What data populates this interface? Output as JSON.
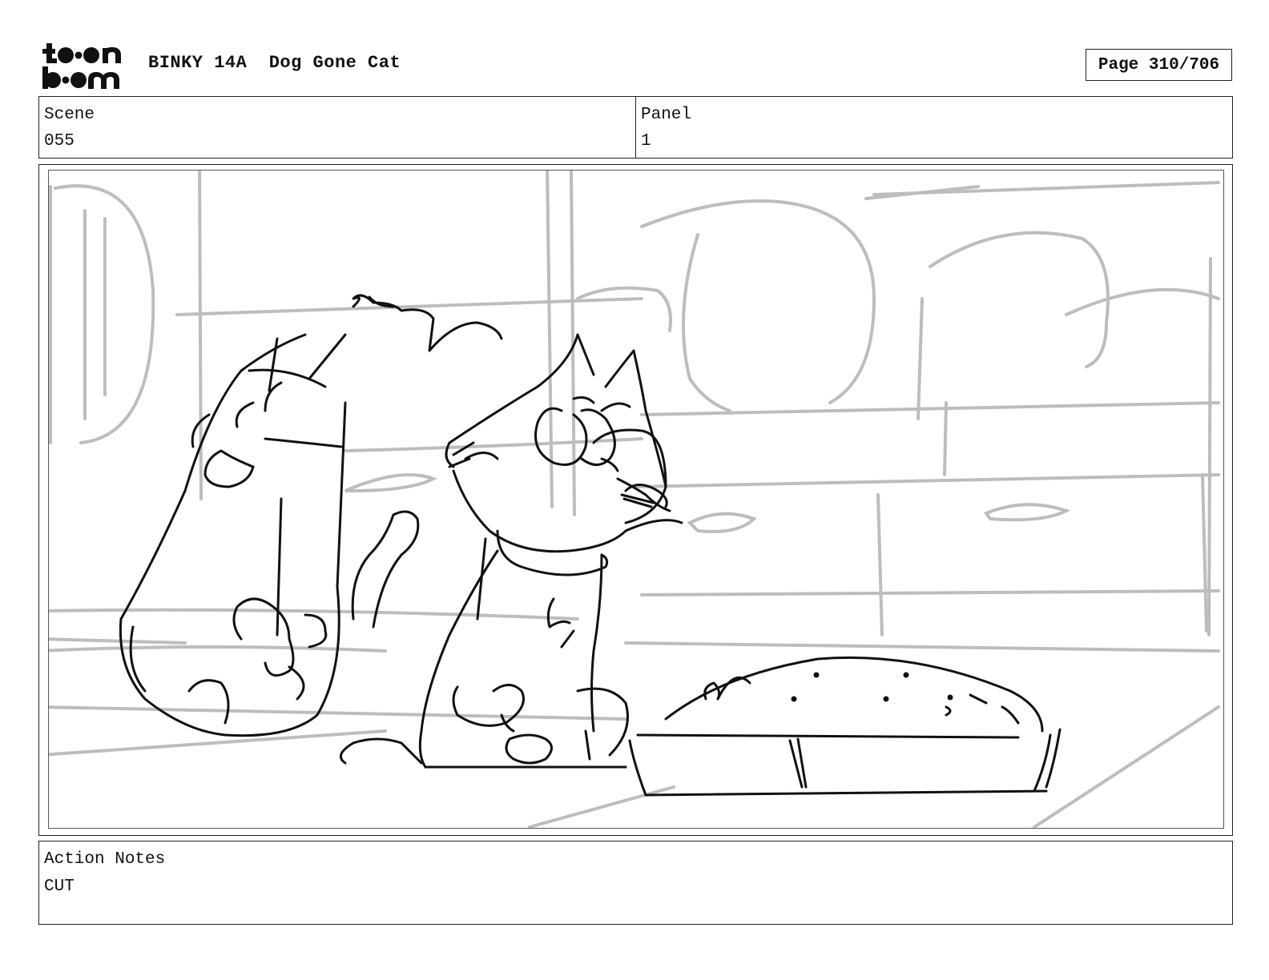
{
  "header": {
    "logo_text_top": "toon",
    "logo_text_bottom": "boom",
    "production": "BINKY 14A",
    "episode": "Dog Gone Cat",
    "page_label": "Page 310/706"
  },
  "info": {
    "scene_label": "Scene",
    "scene_value": "055",
    "panel_label": "Panel",
    "panel_value": "1"
  },
  "notes": {
    "label": "Action Notes",
    "text": "CUT"
  }
}
